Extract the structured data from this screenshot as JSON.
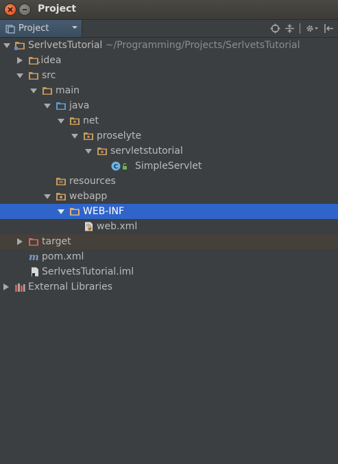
{
  "window": {
    "title": "Project"
  },
  "toolbar": {
    "view_label": "Project"
  },
  "tree": {
    "root": {
      "name": "SerlvetsTutorial",
      "path": "~/Programming/Projects/SerlvetsTutorial"
    },
    "idea": "idea",
    "src": "src",
    "main": "main",
    "java": "java",
    "net": "net",
    "proselyte": "proselyte",
    "servletstutorial": "servletstutorial",
    "simpleservlet": "SimpleServlet",
    "resources": "resources",
    "webapp": "webapp",
    "webinf": "WEB-INF",
    "webxml": "web.xml",
    "target": "target",
    "pom": "pom.xml",
    "iml": "SerlvetsTutorial.iml",
    "external_libraries": "External Libraries"
  },
  "colors": {
    "background": "#3c3f41",
    "selection": "#2f65ca",
    "excluded_row": "#45403a",
    "folder": "#c69a5d",
    "source_folder": "#5a9bd1",
    "excluded_folder": "#d0675d",
    "class_icon": "#6cb6e6"
  },
  "icons": {
    "close": "close-icon",
    "minimize": "minimize-icon",
    "locate": "locate-icon",
    "collapse": "collapse-icon",
    "settings": "gear-icon",
    "hide": "hide-icon"
  }
}
